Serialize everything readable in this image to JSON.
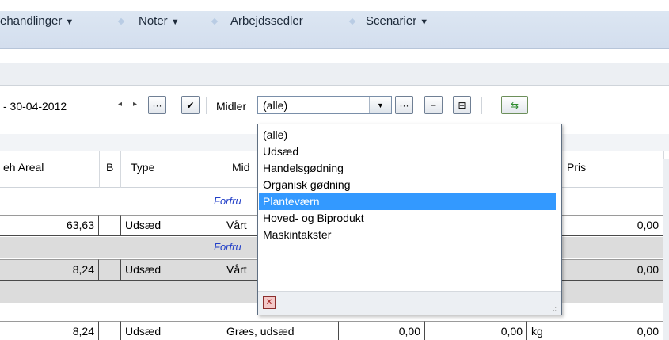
{
  "menubar": {
    "items": [
      {
        "label": "ehandlinger",
        "caret": "▼"
      },
      {
        "label": "Noter",
        "caret": "▼"
      },
      {
        "label": "Arbejdssedler",
        "caret": ""
      },
      {
        "label": "Scenarier",
        "caret": "▼"
      }
    ]
  },
  "toolbar": {
    "date_range": "- 30-04-2012",
    "prev_arrow": "◂",
    "next_arrow": "▸",
    "more_label": "···",
    "ok_label": "✔",
    "midler_label": "Midler",
    "select_value": "(alle)",
    "select_caret": "▼",
    "more2_label": "···",
    "minus_label": "−",
    "grid_add_label": "⊞",
    "refresh_label": "⇆"
  },
  "grid": {
    "headers": [
      "eh Areal",
      "B",
      "Type",
      "Mid",
      "Pris"
    ],
    "groups": [
      {
        "label": "Forfru"
      },
      {
        "label": "Forfru"
      }
    ],
    "rows": [
      {
        "areal": "63,63",
        "type": "Udsæd",
        "middel": "Vårt",
        "pris": "0,00"
      },
      {
        "areal": "8,24",
        "type": "Udsæd",
        "middel": "Vårt",
        "pris": "0,00"
      },
      {
        "areal": "8,24",
        "type": "Udsæd",
        "middel": "Græs, udsæd",
        "val1": "0,00",
        "val2": "0,00",
        "unit": "kg",
        "pris": "0,00"
      }
    ]
  },
  "dropdown": {
    "options": [
      "(alle)",
      "Udsæd",
      "Handelsgødning",
      "Organisk gødning",
      "Planteværn",
      "Hoved- og Biprodukt",
      "Maskintakster"
    ],
    "selected_index": 4,
    "close_label": "✕",
    "grip": ".:"
  },
  "colors": {
    "menu_bg": "#d3deee",
    "selection": "#3399ff",
    "group_text": "#2340c8"
  }
}
